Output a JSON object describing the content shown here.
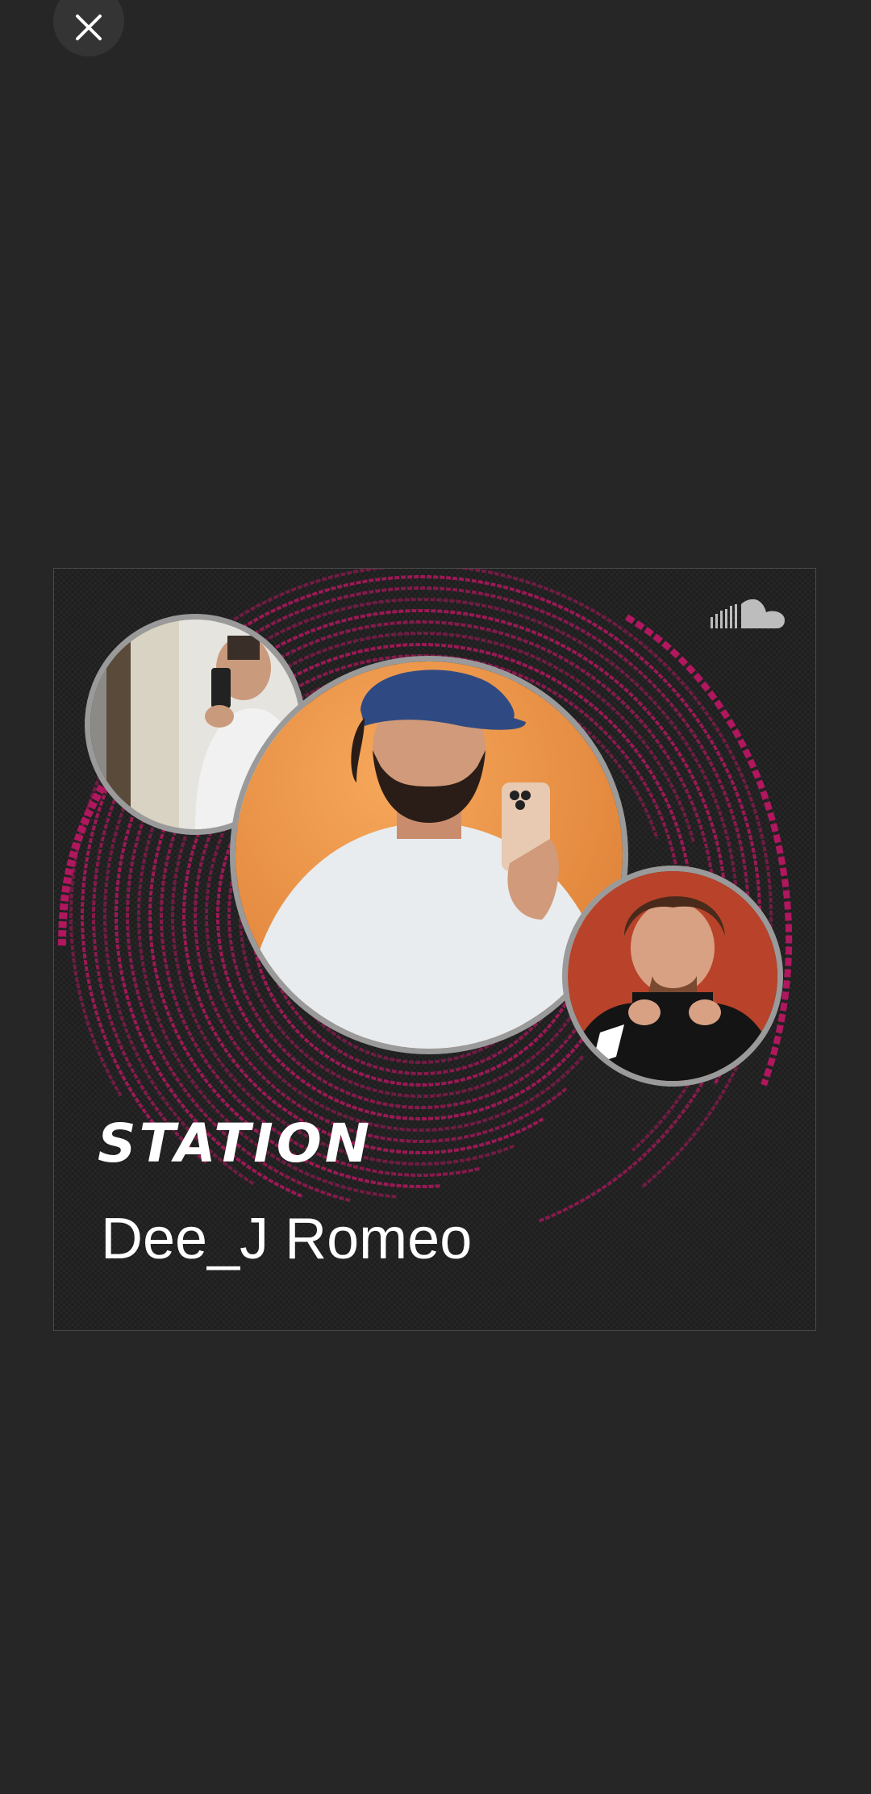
{
  "close_button": {
    "icon": "close-icon",
    "label": "Close"
  },
  "artwork": {
    "type_label": "STATION",
    "artist_name": "Dee_J Romeo",
    "brand_icon": "soundcloud-logo-icon",
    "accent_color": "#b0175e",
    "photos": [
      "artist-photo-left",
      "artist-photo-main",
      "artist-photo-right"
    ]
  }
}
